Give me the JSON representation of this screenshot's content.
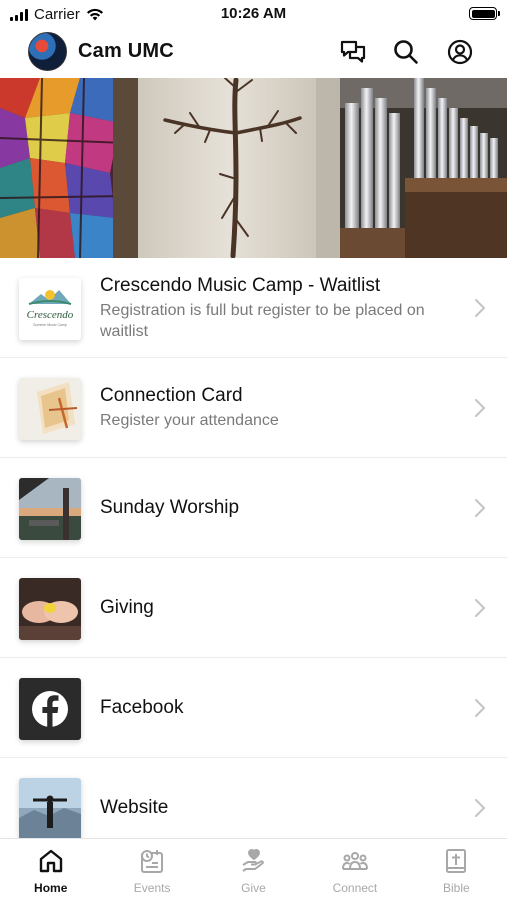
{
  "status_bar": {
    "carrier": "Carrier",
    "time": "10:26 AM"
  },
  "header": {
    "title": "Cam UMC",
    "icons": [
      "chat-icon",
      "search-icon",
      "profile-icon"
    ]
  },
  "hero": {
    "icon": "hero-banner"
  },
  "list": [
    {
      "title": "Crescendo Music Camp - Waitlist",
      "subtitle": "Registration is full but register to be placed on waitlist",
      "thumb_text": "Crescendo",
      "thumb_small": "Summer Music Camp"
    },
    {
      "title": "Connection Card",
      "subtitle": "Register your attendance"
    },
    {
      "title": "Sunday Worship",
      "subtitle": ""
    },
    {
      "title": "Giving",
      "subtitle": ""
    },
    {
      "title": "Facebook",
      "subtitle": ""
    },
    {
      "title": "Website",
      "subtitle": ""
    }
  ],
  "tabs": [
    {
      "label": "Home",
      "icon": "home-icon",
      "active": true
    },
    {
      "label": "Events",
      "icon": "events-icon",
      "active": false
    },
    {
      "label": "Give",
      "icon": "give-icon",
      "active": false
    },
    {
      "label": "Connect",
      "icon": "connect-icon",
      "active": false
    },
    {
      "label": "Bible",
      "icon": "bible-icon",
      "active": false
    }
  ]
}
